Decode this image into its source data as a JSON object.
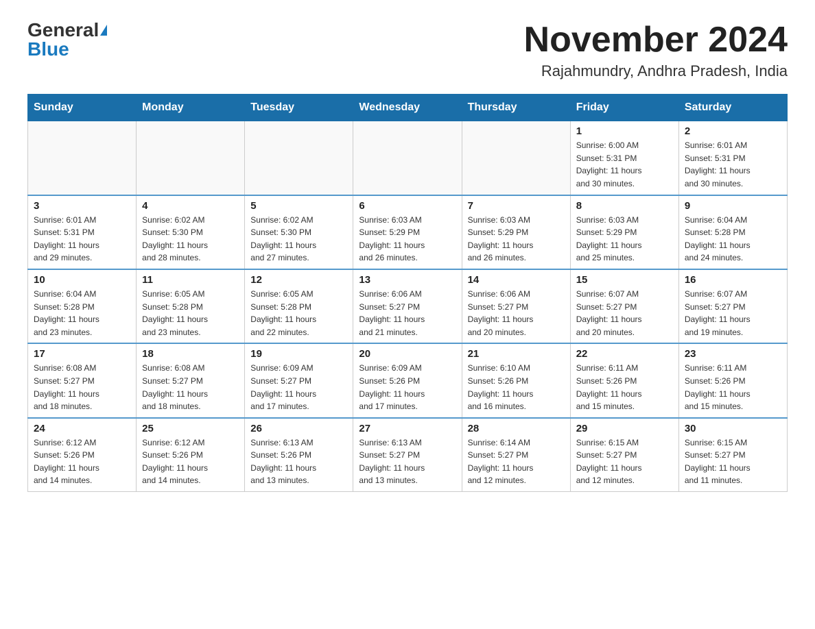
{
  "header": {
    "logo_general": "General",
    "logo_blue": "Blue",
    "month_title": "November 2024",
    "location": "Rajahmundry, Andhra Pradesh, India"
  },
  "weekdays": [
    "Sunday",
    "Monday",
    "Tuesday",
    "Wednesday",
    "Thursday",
    "Friday",
    "Saturday"
  ],
  "weeks": [
    {
      "days": [
        {
          "num": "",
          "info": ""
        },
        {
          "num": "",
          "info": ""
        },
        {
          "num": "",
          "info": ""
        },
        {
          "num": "",
          "info": ""
        },
        {
          "num": "",
          "info": ""
        },
        {
          "num": "1",
          "info": "Sunrise: 6:00 AM\nSunset: 5:31 PM\nDaylight: 11 hours\nand 30 minutes."
        },
        {
          "num": "2",
          "info": "Sunrise: 6:01 AM\nSunset: 5:31 PM\nDaylight: 11 hours\nand 30 minutes."
        }
      ]
    },
    {
      "days": [
        {
          "num": "3",
          "info": "Sunrise: 6:01 AM\nSunset: 5:31 PM\nDaylight: 11 hours\nand 29 minutes."
        },
        {
          "num": "4",
          "info": "Sunrise: 6:02 AM\nSunset: 5:30 PM\nDaylight: 11 hours\nand 28 minutes."
        },
        {
          "num": "5",
          "info": "Sunrise: 6:02 AM\nSunset: 5:30 PM\nDaylight: 11 hours\nand 27 minutes."
        },
        {
          "num": "6",
          "info": "Sunrise: 6:03 AM\nSunset: 5:29 PM\nDaylight: 11 hours\nand 26 minutes."
        },
        {
          "num": "7",
          "info": "Sunrise: 6:03 AM\nSunset: 5:29 PM\nDaylight: 11 hours\nand 26 minutes."
        },
        {
          "num": "8",
          "info": "Sunrise: 6:03 AM\nSunset: 5:29 PM\nDaylight: 11 hours\nand 25 minutes."
        },
        {
          "num": "9",
          "info": "Sunrise: 6:04 AM\nSunset: 5:28 PM\nDaylight: 11 hours\nand 24 minutes."
        }
      ]
    },
    {
      "days": [
        {
          "num": "10",
          "info": "Sunrise: 6:04 AM\nSunset: 5:28 PM\nDaylight: 11 hours\nand 23 minutes."
        },
        {
          "num": "11",
          "info": "Sunrise: 6:05 AM\nSunset: 5:28 PM\nDaylight: 11 hours\nand 23 minutes."
        },
        {
          "num": "12",
          "info": "Sunrise: 6:05 AM\nSunset: 5:28 PM\nDaylight: 11 hours\nand 22 minutes."
        },
        {
          "num": "13",
          "info": "Sunrise: 6:06 AM\nSunset: 5:27 PM\nDaylight: 11 hours\nand 21 minutes."
        },
        {
          "num": "14",
          "info": "Sunrise: 6:06 AM\nSunset: 5:27 PM\nDaylight: 11 hours\nand 20 minutes."
        },
        {
          "num": "15",
          "info": "Sunrise: 6:07 AM\nSunset: 5:27 PM\nDaylight: 11 hours\nand 20 minutes."
        },
        {
          "num": "16",
          "info": "Sunrise: 6:07 AM\nSunset: 5:27 PM\nDaylight: 11 hours\nand 19 minutes."
        }
      ]
    },
    {
      "days": [
        {
          "num": "17",
          "info": "Sunrise: 6:08 AM\nSunset: 5:27 PM\nDaylight: 11 hours\nand 18 minutes."
        },
        {
          "num": "18",
          "info": "Sunrise: 6:08 AM\nSunset: 5:27 PM\nDaylight: 11 hours\nand 18 minutes."
        },
        {
          "num": "19",
          "info": "Sunrise: 6:09 AM\nSunset: 5:27 PM\nDaylight: 11 hours\nand 17 minutes."
        },
        {
          "num": "20",
          "info": "Sunrise: 6:09 AM\nSunset: 5:26 PM\nDaylight: 11 hours\nand 17 minutes."
        },
        {
          "num": "21",
          "info": "Sunrise: 6:10 AM\nSunset: 5:26 PM\nDaylight: 11 hours\nand 16 minutes."
        },
        {
          "num": "22",
          "info": "Sunrise: 6:11 AM\nSunset: 5:26 PM\nDaylight: 11 hours\nand 15 minutes."
        },
        {
          "num": "23",
          "info": "Sunrise: 6:11 AM\nSunset: 5:26 PM\nDaylight: 11 hours\nand 15 minutes."
        }
      ]
    },
    {
      "days": [
        {
          "num": "24",
          "info": "Sunrise: 6:12 AM\nSunset: 5:26 PM\nDaylight: 11 hours\nand 14 minutes."
        },
        {
          "num": "25",
          "info": "Sunrise: 6:12 AM\nSunset: 5:26 PM\nDaylight: 11 hours\nand 14 minutes."
        },
        {
          "num": "26",
          "info": "Sunrise: 6:13 AM\nSunset: 5:26 PM\nDaylight: 11 hours\nand 13 minutes."
        },
        {
          "num": "27",
          "info": "Sunrise: 6:13 AM\nSunset: 5:27 PM\nDaylight: 11 hours\nand 13 minutes."
        },
        {
          "num": "28",
          "info": "Sunrise: 6:14 AM\nSunset: 5:27 PM\nDaylight: 11 hours\nand 12 minutes."
        },
        {
          "num": "29",
          "info": "Sunrise: 6:15 AM\nSunset: 5:27 PM\nDaylight: 11 hours\nand 12 minutes."
        },
        {
          "num": "30",
          "info": "Sunrise: 6:15 AM\nSunset: 5:27 PM\nDaylight: 11 hours\nand 11 minutes."
        }
      ]
    }
  ]
}
